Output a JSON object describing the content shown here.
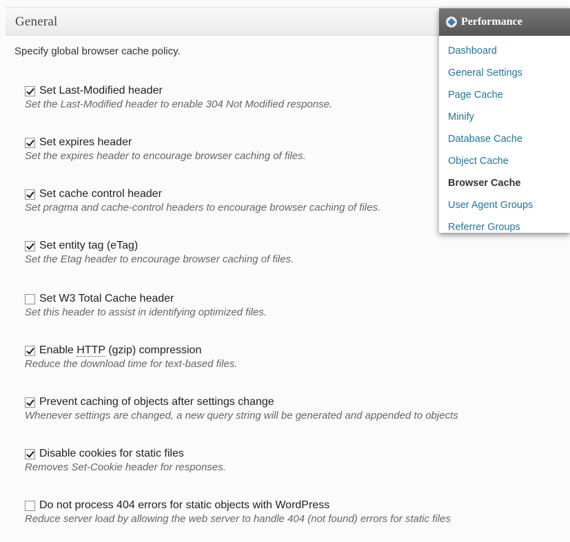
{
  "panel": {
    "title": "General",
    "intro": "Specify global browser cache policy."
  },
  "options": [
    {
      "checked": true,
      "label": "Set Last-Modified header",
      "description": "Set the Last-Modified header to enable 304 Not Modified response."
    },
    {
      "checked": true,
      "label": "Set expires header",
      "description": "Set the expires header to encourage browser caching of files."
    },
    {
      "checked": true,
      "label": "Set cache control header",
      "description": "Set pragma and cache-control headers to encourage browser caching of files."
    },
    {
      "checked": true,
      "label": "Set entity tag (eTag)",
      "description": "Set the Etag header to encourage browser caching of files."
    },
    {
      "checked": false,
      "label": "Set W3 Total Cache header",
      "description": "Set this header to assist in identifying optimized files."
    },
    {
      "checked": true,
      "label_prefix": "Enable ",
      "label_abbr": "HTTP",
      "label_suffix": " (gzip) compression",
      "description": "Reduce the download time for text-based files."
    },
    {
      "checked": true,
      "label": "Prevent caching of objects after settings change",
      "description": "Whenever settings are changed, a new query string will be generated and appended to objects"
    },
    {
      "checked": true,
      "label": "Disable cookies for static files",
      "description": "Removes Set-Cookie header for responses."
    },
    {
      "checked": false,
      "label": "Do not process 404 errors for static objects with WordPress",
      "description": "Reduce server load by allowing the web server to handle 404 (not found) errors for static files"
    }
  ],
  "performance_menu": {
    "title": "Performance",
    "icon": "w3tc-logo-icon",
    "items": [
      {
        "label": "Dashboard",
        "current": false
      },
      {
        "label": "General Settings",
        "current": false
      },
      {
        "label": "Page Cache",
        "current": false
      },
      {
        "label": "Minify",
        "current": false
      },
      {
        "label": "Database Cache",
        "current": false
      },
      {
        "label": "Object Cache",
        "current": false
      },
      {
        "label": "Browser Cache",
        "current": true
      },
      {
        "label": "User Agent Groups",
        "current": false
      },
      {
        "label": "Referrer Groups",
        "current": false
      }
    ]
  }
}
